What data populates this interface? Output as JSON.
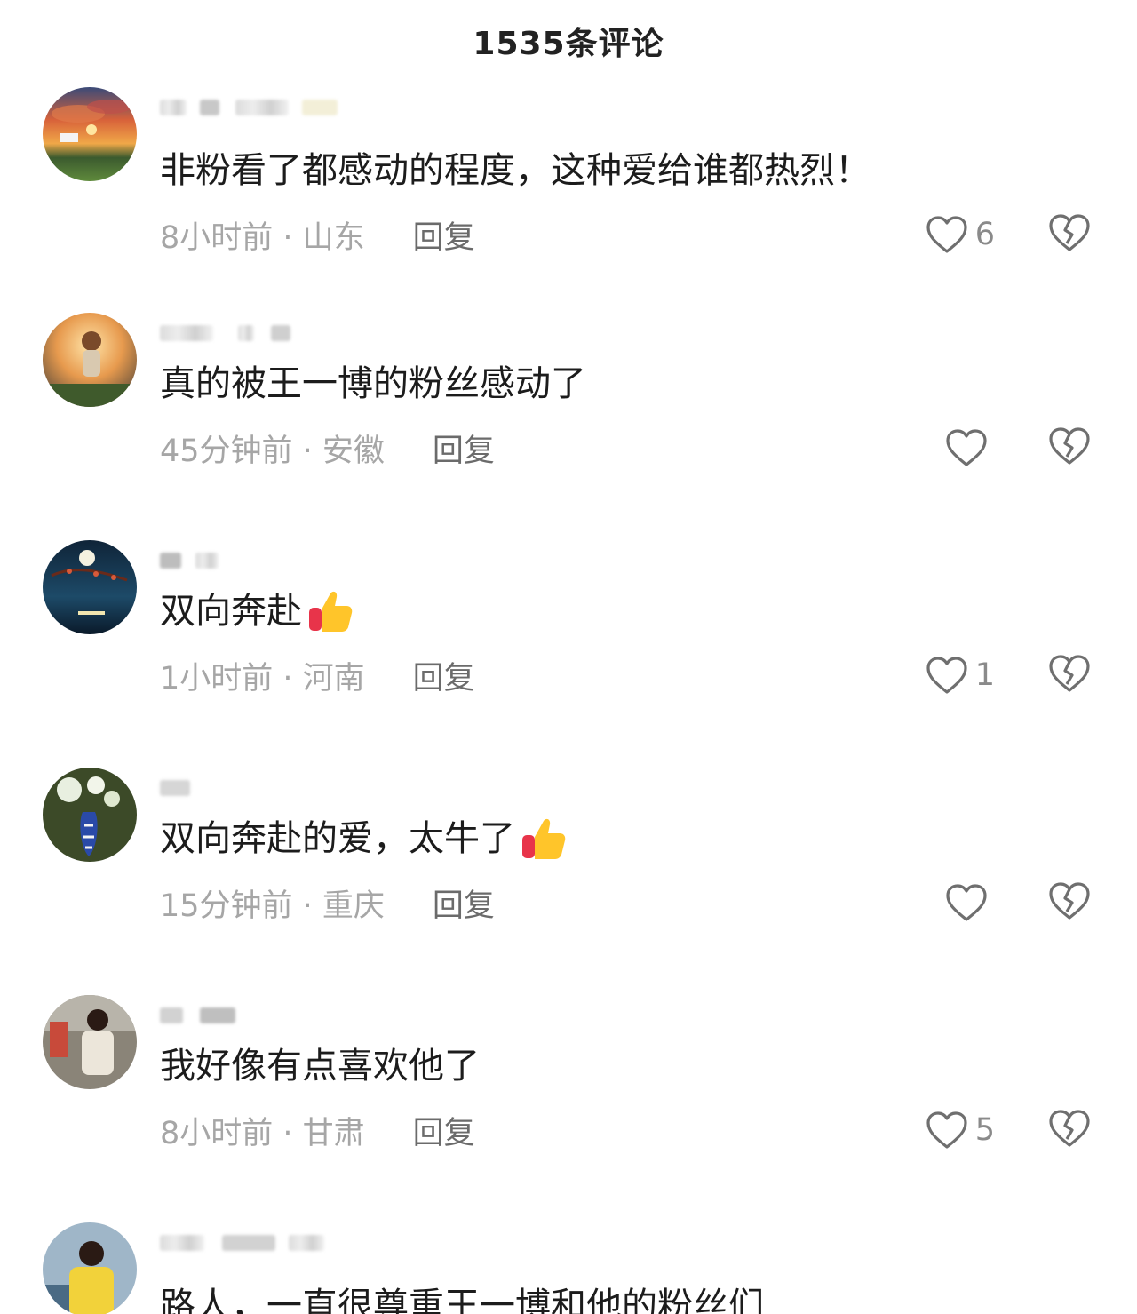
{
  "header": {
    "title": "1535条评论"
  },
  "icons": {
    "like": "heart-outline-icon",
    "dislike": "broken-heart-icon",
    "emoji": "thumbs-up-emoji"
  },
  "comments": [
    {
      "text": "非粉看了都感动的程度，这种爱给谁都热烈！",
      "time_location": "8小时前 · 山东",
      "reply": "回复",
      "likes": "6",
      "emoji": false
    },
    {
      "text": "真的被王一博的粉丝感动了",
      "time_location": "45分钟前 · 安徽",
      "reply": "回复",
      "likes": "",
      "emoji": false
    },
    {
      "text": "双向奔赴",
      "time_location": "1小时前 · 河南",
      "reply": "回复",
      "likes": "1",
      "emoji": true
    },
    {
      "text": "双向奔赴的爱，太牛了",
      "time_location": "15分钟前 · 重庆",
      "reply": "回复",
      "likes": "",
      "emoji": true
    },
    {
      "text": "我好像有点喜欢他了",
      "time_location": "8小时前 · 甘肃",
      "reply": "回复",
      "likes": "5",
      "emoji": false
    },
    {
      "text": "路人，一直很尊重王一博和他的粉丝们",
      "time_location": "",
      "reply": "",
      "likes": "",
      "emoji": false
    }
  ]
}
